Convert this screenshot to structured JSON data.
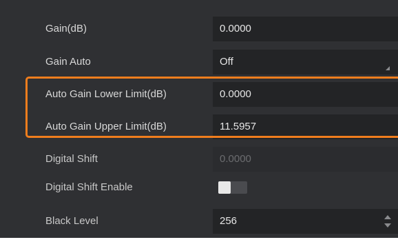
{
  "properties": [
    {
      "label": "Gain(dB)",
      "value": "0.0000"
    },
    {
      "label": "Gain Auto",
      "value": "Off"
    },
    {
      "label": "Auto Gain Lower Limit(dB)",
      "value": "0.0000"
    },
    {
      "label": "Auto Gain Upper Limit(dB)",
      "value": "11.5957"
    },
    {
      "label": "Digital Shift",
      "value": "0.0000"
    },
    {
      "label": "Digital Shift Enable",
      "value": false
    },
    {
      "label": "Black Level",
      "value": "256"
    }
  ],
  "colors": {
    "panel_bg": "#2f3033",
    "field_bg": "#232426",
    "highlight": "#f07d1d"
  }
}
